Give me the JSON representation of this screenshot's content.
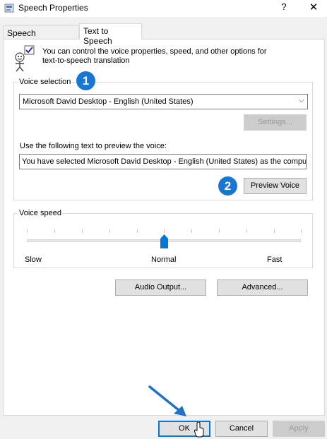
{
  "window": {
    "title": "Speech Properties",
    "help_label": "?",
    "close_label": "✕"
  },
  "tabs": [
    {
      "label": "Speech Recognition",
      "active": false
    },
    {
      "label": "Text to Speech",
      "active": true
    }
  ],
  "intro": {
    "text": "You can control the voice properties, speed, and other options for text-to-speech translation",
    "icon": "speech-agent-icon"
  },
  "voice_selection": {
    "legend": "Voice selection",
    "selected_voice": "Microsoft David Desktop - English (United States)",
    "settings_label": "Settings...",
    "preview_label_text": "Use the following text to preview the voice:",
    "preview_text": "You have selected Microsoft David Desktop - English (United States) as the computer's default voice.",
    "preview_button": "Preview Voice"
  },
  "voice_speed": {
    "legend": "Voice speed",
    "slow_label": "Slow",
    "normal_label": "Normal",
    "fast_label": "Fast",
    "level": 0.5
  },
  "buttons": {
    "audio_output": "Audio Output...",
    "advanced": "Advanced...",
    "ok": "OK",
    "cancel": "Cancel",
    "apply": "Apply"
  },
  "annotations": {
    "badge1": "1",
    "badge2": "2",
    "arrow_color": "#1e73c8",
    "badge_color": "#1976d2"
  }
}
